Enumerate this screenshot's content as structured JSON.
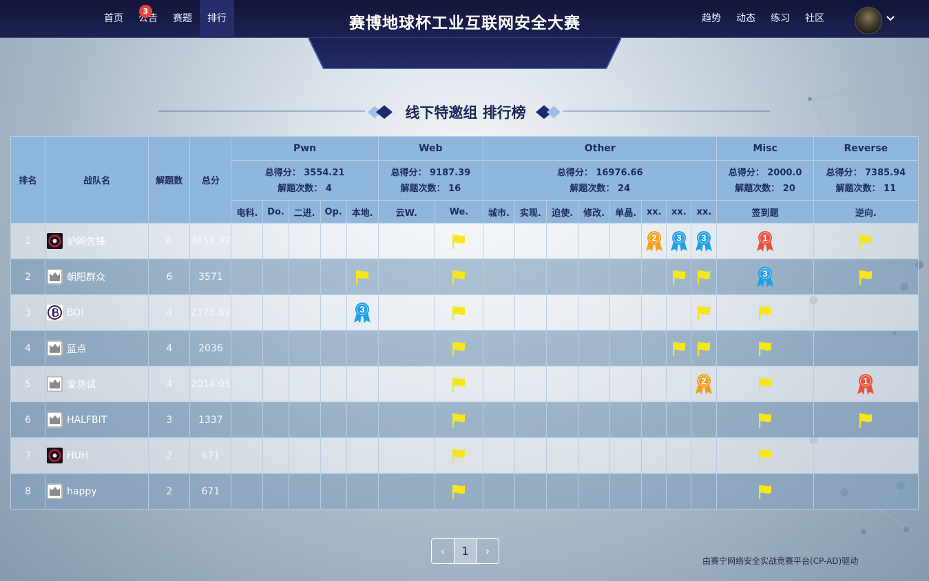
{
  "nav": {
    "left": [
      {
        "label": "首页"
      },
      {
        "label": "公告",
        "badge": "3"
      },
      {
        "label": "赛题"
      },
      {
        "label": "排行",
        "active": true
      }
    ],
    "right": [
      {
        "label": "趋势"
      },
      {
        "label": "动态"
      },
      {
        "label": "练习"
      },
      {
        "label": "社区"
      }
    ]
  },
  "site_title": "赛博地球杯工业互联网安全大赛",
  "heading": "线下特邀组 排行榜",
  "table": {
    "fixed_headers": {
      "rank": "排名",
      "team": "战队名",
      "solved": "解题数",
      "score": "总分"
    },
    "categories": [
      {
        "name": "Pwn",
        "total": "总得分： 3554.21",
        "count": "解题次数： 4",
        "challenges": [
          "电科.",
          "Do.",
          "二进.",
          "Op.",
          "本地."
        ]
      },
      {
        "name": "Web",
        "total": "总得分： 9187.39",
        "count": "解题次数： 16",
        "challenges": [
          "云W.",
          "We."
        ]
      },
      {
        "name": "Other",
        "total": "总得分： 16976.66",
        "count": "解题次数： 24",
        "challenges": [
          "城市.",
          "实现.",
          "迫使.",
          "修改.",
          "单晶.",
          "xx.",
          "xx.",
          "xx."
        ]
      },
      {
        "name": "Misc",
        "total": "总得分： 2000.0",
        "count": "解题次数： 20",
        "challenges": [
          "签到题"
        ]
      },
      {
        "name": "Reverse",
        "total": "总得分： 7385.94",
        "count": "解题次数： 11",
        "challenges": [
          "逆向."
        ]
      }
    ],
    "rows": [
      {
        "rank": "1",
        "team": "护网先锋",
        "logo": "red-logo",
        "solved": "6",
        "score": "3651.92",
        "marks": [
          "",
          "",
          "",
          "",
          "",
          "",
          "flag",
          "",
          "",
          "",
          "",
          "",
          "m2",
          "m3",
          "m3",
          "m1",
          "flag"
        ]
      },
      {
        "rank": "2",
        "team": "朝阳群众",
        "logo": "placeholder-logo",
        "solved": "6",
        "score": "3571",
        "marks": [
          "",
          "",
          "",
          "",
          "flag",
          "",
          "flag",
          "",
          "",
          "",
          "",
          "",
          "",
          "flag",
          "flag",
          "m3",
          "flag"
        ]
      },
      {
        "rank": "3",
        "team": "BOI",
        "logo": "bitcoin-logo",
        "solved": "4",
        "score": "2173.69",
        "marks": [
          "",
          "",
          "",
          "",
          "m3",
          "",
          "flag",
          "",
          "",
          "",
          "",
          "",
          "",
          "",
          "flag",
          "flag",
          ""
        ]
      },
      {
        "rank": "4",
        "team": "蓝点",
        "logo": "placeholder-logo",
        "solved": "4",
        "score": "2036",
        "marks": [
          "",
          "",
          "",
          "",
          "",
          "",
          "flag",
          "",
          "",
          "",
          "",
          "",
          "",
          "flag",
          "flag",
          "flag",
          ""
        ]
      },
      {
        "rank": "5",
        "team": "爱测试",
        "logo": "placeholder-logo",
        "solved": "4",
        "score": "2014.05",
        "marks": [
          "",
          "",
          "",
          "",
          "",
          "",
          "flag",
          "",
          "",
          "",
          "",
          "",
          "",
          "",
          "m2",
          "flag",
          "m1"
        ]
      },
      {
        "rank": "6",
        "team": "HALFBIT",
        "logo": "placeholder-logo",
        "solved": "3",
        "score": "1337",
        "marks": [
          "",
          "",
          "",
          "",
          "",
          "",
          "flag",
          "",
          "",
          "",
          "",
          "",
          "",
          "",
          "",
          "flag",
          "flag"
        ]
      },
      {
        "rank": "7",
        "team": "HUH",
        "logo": "red-logo",
        "solved": "2",
        "score": "671",
        "marks": [
          "",
          "",
          "",
          "",
          "",
          "",
          "flag",
          "",
          "",
          "",
          "",
          "",
          "",
          "",
          "",
          "flag",
          ""
        ]
      },
      {
        "rank": "8",
        "team": "happy",
        "logo": "placeholder-logo",
        "solved": "2",
        "score": "671",
        "marks": [
          "",
          "",
          "",
          "",
          "",
          "",
          "flag",
          "",
          "",
          "",
          "",
          "",
          "",
          "",
          "",
          "flag",
          ""
        ]
      }
    ]
  },
  "medals": {
    "m1": {
      "label": "1",
      "color": "#e8523a"
    },
    "m2": {
      "label": "2",
      "color": "#f0a020"
    },
    "m3": {
      "label": "3",
      "color": "#1ea0e6"
    }
  },
  "icons": {
    "flag": "flag-icon",
    "medal": "medal-icon",
    "caret": "chevron-down-icon"
  },
  "colors": {
    "flag": "#f5e61e",
    "header_bg": "#8fb6dc",
    "topbar": "#121538"
  },
  "pagination": {
    "prev": "‹",
    "page": "1",
    "next": "›"
  },
  "footer": "由赛宁网络安全实战竞赛平台(CP-AD)驱动"
}
